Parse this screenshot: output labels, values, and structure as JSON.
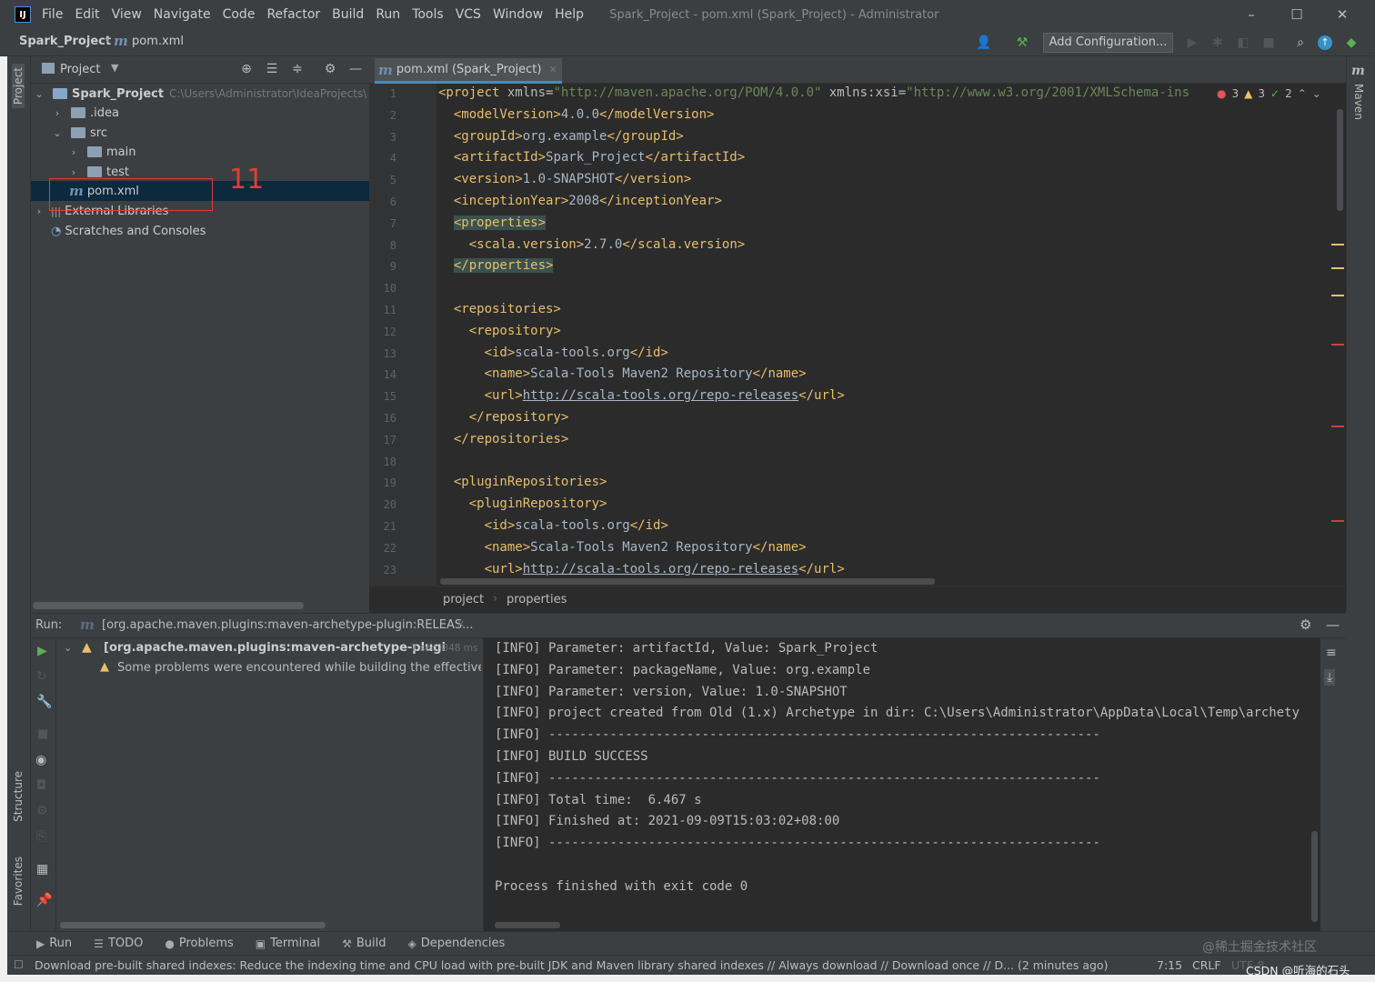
{
  "menu": {
    "items": [
      "File",
      "Edit",
      "View",
      "Navigate",
      "Code",
      "Refactor",
      "Build",
      "Run",
      "Tools",
      "VCS",
      "Window",
      "Help"
    ],
    "window_title": "Spark_Project - pom.xml (Spark_Project) - Administrator"
  },
  "navbar": {
    "project": "Spark_Project",
    "file": "pom.xml",
    "add_configuration": "Add Configuration..."
  },
  "left_strip": {
    "project": "Project",
    "structure": "Structure",
    "favorites": "Favorites"
  },
  "right_strip": {
    "maven": "Maven"
  },
  "project_panel": {
    "title": "Project",
    "root_name": "Spark_Project",
    "root_path": "C:\\Users\\Administrator\\IdeaProjects\\",
    "idea": ".idea",
    "src": "src",
    "main": "main",
    "test": "test",
    "pom": "pom.xml",
    "external_libraries": "External Libraries",
    "scratches": "Scratches and Consoles",
    "annotation": "11"
  },
  "editor": {
    "tab_label": "pom.xml (Spark_Project)",
    "inspection": {
      "errors": "3",
      "warnings": "3",
      "ok": "2"
    },
    "lines": [
      {
        "n": "1",
        "html": "<span class='t'>&lt;project </span><span class='a'>xmlns=</span><span class='s'>\"http://maven.apache.org/POM/4.0.0\"</span><span class='a'> xmlns:xsi=</span><span class='s'>\"http://www.w3.org/2001/XMLSchema-ins</span>"
      },
      {
        "n": "2",
        "html": "  <span class='t'>&lt;modelVersion&gt;</span><span class='v'>4.0.0</span><span class='t'>&lt;/modelVersion&gt;</span>"
      },
      {
        "n": "3",
        "html": "  <span class='t'>&lt;groupId&gt;</span><span class='v'>org.example</span><span class='t'>&lt;/groupId&gt;</span>"
      },
      {
        "n": "4",
        "html": "  <span class='t'>&lt;artifactId&gt;</span><span class='v'>Spark_Project</span><span class='t'>&lt;/artifactId&gt;</span>"
      },
      {
        "n": "5",
        "html": "  <span class='t'>&lt;version&gt;</span><span class='v'>1.0-SNAPSHOT</span><span class='t'>&lt;/version&gt;</span>"
      },
      {
        "n": "6",
        "html": "  <span class='t'>&lt;inceptionYear&gt;</span><span class='v'>2008</span><span class='t'>&lt;/inceptionYear&gt;</span>"
      },
      {
        "n": "7",
        "html": "  <span class='t hl-tag'>&lt;properties&gt;</span>"
      },
      {
        "n": "8",
        "html": "    <span class='t'>&lt;scala.version&gt;</span><span class='v'>2.7.0</span><span class='t'>&lt;/scala.version&gt;</span>"
      },
      {
        "n": "9",
        "html": "  <span class='t hl-tag'>&lt;/properties&gt;</span>"
      },
      {
        "n": "10",
        "html": ""
      },
      {
        "n": "11",
        "html": "  <span class='t'>&lt;repositories&gt;</span>"
      },
      {
        "n": "12",
        "html": "    <span class='t'>&lt;repository&gt;</span>"
      },
      {
        "n": "13",
        "html": "      <span class='t'>&lt;id&gt;</span><span class='v'>scala-tools.org</span><span class='t'>&lt;/id&gt;</span>"
      },
      {
        "n": "14",
        "html": "      <span class='t'>&lt;name&gt;</span><span class='v'>Scala-Tools Maven2 Repository</span><span class='t'>&lt;/name&gt;</span>"
      },
      {
        "n": "15",
        "html": "      <span class='t'>&lt;url&gt;</span><span class='u'>http://scala-tools.org/repo-releases</span><span class='t'>&lt;/url&gt;</span>"
      },
      {
        "n": "16",
        "html": "    <span class='t'>&lt;/repository&gt;</span>"
      },
      {
        "n": "17",
        "html": "  <span class='t'>&lt;/repositories&gt;</span>"
      },
      {
        "n": "18",
        "html": ""
      },
      {
        "n": "19",
        "html": "  <span class='t'>&lt;pluginRepositories&gt;</span>"
      },
      {
        "n": "20",
        "html": "    <span class='t'>&lt;pluginRepository&gt;</span>"
      },
      {
        "n": "21",
        "html": "      <span class='t'>&lt;id&gt;</span><span class='v'>scala-tools.org</span><span class='t'>&lt;/id&gt;</span>"
      },
      {
        "n": "22",
        "html": "      <span class='t'>&lt;name&gt;</span><span class='v'>Scala-Tools Maven2 Repository</span><span class='t'>&lt;/name&gt;</span>"
      },
      {
        "n": "23",
        "html": "      <span class='t'>&lt;url&gt;</span><span class='u'>http://scala-tools.org/repo-releases</span><span class='t'>&lt;/url&gt;</span>"
      }
    ],
    "breadcrumb": [
      "project",
      "properties"
    ]
  },
  "run": {
    "label": "Run:",
    "tab": "[org.apache.maven.plugins:maven-archetype-plugin:RELEAS...",
    "tree_item": "[org.apache.maven.plugins:maven-archetype-plugi",
    "tree_time": "7 sec, 848 ms",
    "tree_warning": "Some problems were encountered while building the effective s",
    "console": [
      "[INFO] Parameter: artifactId, Value: Spark_Project",
      "[INFO] Parameter: packageName, Value: org.example",
      "[INFO] Parameter: version, Value: 1.0-SNAPSHOT",
      "[INFO] project created from Old (1.x) Archetype in dir: C:\\Users\\Administrator\\AppData\\Local\\Temp\\archety",
      "[INFO] ------------------------------------------------------------------------",
      "[INFO] BUILD SUCCESS",
      "[INFO] ------------------------------------------------------------------------",
      "[INFO] Total time:  6.467 s",
      "[INFO] Finished at: 2021-09-09T15:03:02+08:00",
      "[INFO] ------------------------------------------------------------------------",
      "",
      "Process finished with exit code 0"
    ]
  },
  "bottom_tabs": [
    "Run",
    "TODO",
    "Problems",
    "Terminal",
    "Build",
    "Dependencies"
  ],
  "status": {
    "message": "Download pre-built shared indexes: Reduce the indexing time and CPU load with pre-built JDK and Maven library shared indexes // Always download // Download once // D... (2 minutes ago)",
    "position": "7:15",
    "line_sep": "CRLF",
    "encoding": "UTF-8",
    "watermark": "@稀土掘金技术社区",
    "watermark2": "CSDN @听海的石头"
  },
  "colors": {
    "accent": "#4a88c7",
    "annotation_red": "#e03c3c",
    "error": "#e05555",
    "warning": "#e8bf6a",
    "ok": "#5fad56"
  }
}
